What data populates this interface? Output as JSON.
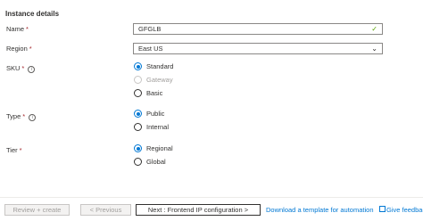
{
  "section": {
    "title": "Instance details"
  },
  "name": {
    "label": "Name",
    "required": "*",
    "value": "GFGLB",
    "icon": "check-icon"
  },
  "region": {
    "label": "Region",
    "required": "*",
    "value": "East US",
    "icon": "chevron-down-icon"
  },
  "sku": {
    "label": "SKU",
    "required": "*",
    "info": "i",
    "options": [
      {
        "label": "Standard",
        "selected": true,
        "disabled": false
      },
      {
        "label": "Gateway",
        "selected": false,
        "disabled": true
      },
      {
        "label": "Basic",
        "selected": false,
        "disabled": false
      }
    ]
  },
  "type": {
    "label": "Type",
    "required": "*",
    "info": "i",
    "options": [
      {
        "label": "Public",
        "selected": true
      },
      {
        "label": "Internal",
        "selected": false
      }
    ]
  },
  "tier": {
    "label": "Tier",
    "required": "*",
    "options": [
      {
        "label": "Regional",
        "selected": true
      },
      {
        "label": "Global",
        "selected": false
      }
    ]
  },
  "footer": {
    "review_label": "Review + create",
    "previous_label": "< Previous",
    "next_label": "Next : Frontend IP configuration >",
    "template_link": "Download a template for automation",
    "feedback_link": "Give feedback"
  },
  "colors": {
    "accent": "#0078d4",
    "required": "#a4262c",
    "valid": "#57a300"
  }
}
